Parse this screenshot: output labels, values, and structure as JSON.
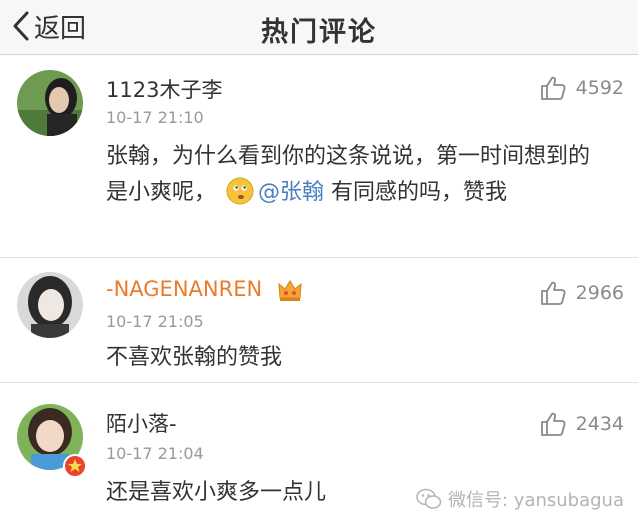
{
  "nav": {
    "back_label": "返回",
    "title": "热门评论"
  },
  "comments": [
    {
      "username": "1123木子李",
      "time": "10-17 21:10",
      "likes": "4592",
      "content_before": "张翰，为什么看到你的这条说说，第一时间想到的是小爽呢，",
      "mention": "@张翰",
      "content_after": " 有同感的吗，赞我"
    },
    {
      "username": "-NAGENANREN",
      "time": "10-17 21:05",
      "likes": "2966",
      "content": "不喜欢张翰的赞我"
    },
    {
      "username": "陌小落-",
      "time": "10-17 21:04",
      "likes": "2434",
      "content": "还是喜欢小爽多一点儿"
    }
  ],
  "watermark": {
    "text": "微信号: yansubagua"
  },
  "colors": {
    "mention": "#4b7fc0",
    "vip_name": "#ec7a2c",
    "timestamp": "#999999"
  }
}
